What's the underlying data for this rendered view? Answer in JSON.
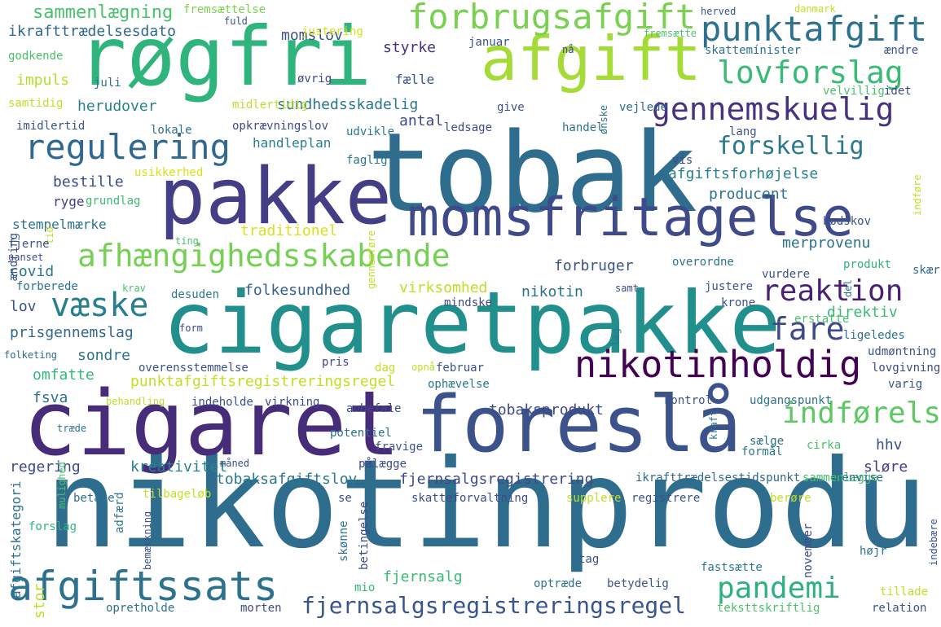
{
  "word_cloud": {
    "words": [
      {
        "text": "nikotinprodukt",
        "color": "#2f6d8e"
      },
      {
        "text": "tobak",
        "color": "#2f6d8e"
      },
      {
        "text": "cigaretpakke",
        "color": "#21908d"
      },
      {
        "text": "røgfri",
        "color": "#2fb47c"
      },
      {
        "text": "pakke",
        "color": "#433e85"
      },
      {
        "text": "cigaret",
        "color": "#472c7a"
      },
      {
        "text": "foreslå",
        "color": "#3b528b"
      },
      {
        "text": "afgift",
        "color": "#a5db36"
      },
      {
        "text": "momsfritagelse",
        "color": "#3e4a89"
      },
      {
        "text": "afgiftssats",
        "color": "#2c718e"
      },
      {
        "text": "forbrugsafgift",
        "color": "#7ad151"
      },
      {
        "text": "punktafgift",
        "color": "#2c728e"
      },
      {
        "text": "lovforslag",
        "color": "#3aba76"
      },
      {
        "text": "afhængighedsskabende",
        "color": "#75d054"
      },
      {
        "text": "nikotinholdig",
        "color": "#440154"
      },
      {
        "text": "regulering",
        "color": "#31688e"
      },
      {
        "text": "gennemskuelig",
        "color": "#46327e"
      },
      {
        "text": "pandemi",
        "color": "#2db27d"
      },
      {
        "text": "reaktion",
        "color": "#482173"
      },
      {
        "text": "indførelse",
        "color": "#5ec962"
      },
      {
        "text": "væske",
        "color": "#277f8e"
      },
      {
        "text": "fare",
        "color": "#3e4989"
      },
      {
        "text": "forskellig",
        "color": "#2a788e"
      },
      {
        "text": "fjernsalgsregistreringsregel",
        "color": "#39558c"
      },
      {
        "text": "sammenlægning",
        "color": "#4ac16d"
      },
      {
        "text": "fremsættelse",
        "color": "#7ad151"
      },
      {
        "text": "ikrafttrædelsesdato",
        "color": "#31688e"
      },
      {
        "text": "momslov",
        "color": "#3b528b"
      },
      {
        "text": "styrke",
        "color": "#46307e"
      },
      {
        "text": "impuls",
        "color": "#b5de2b"
      },
      {
        "text": "fælle",
        "color": "#3b528b"
      },
      {
        "text": "herudover",
        "color": "#26828e"
      },
      {
        "text": "sundhedsskadelig",
        "color": "#2a788e"
      },
      {
        "text": "antal",
        "color": "#3e4989"
      },
      {
        "text": "handleplan",
        "color": "#277f8e"
      },
      {
        "text": "afgiftsforhøjelse",
        "color": "#26828e"
      },
      {
        "text": "producent",
        "color": "#2c728e"
      },
      {
        "text": "bestille",
        "color": "#3e4a89"
      },
      {
        "text": "ryge",
        "color": "#433e85"
      },
      {
        "text": "stempelmærke",
        "color": "#2c728e"
      },
      {
        "text": "traditionel",
        "color": "#d8e219"
      },
      {
        "text": "merprovenu",
        "color": "#2c728e"
      },
      {
        "text": "forbruger",
        "color": "#3b528b"
      },
      {
        "text": "covid",
        "color": "#2a788e"
      },
      {
        "text": "folkesundhed",
        "color": "#35608d"
      },
      {
        "text": "virksomhed",
        "color": "#bddf26"
      },
      {
        "text": "nikotin",
        "color": "#2c728e"
      },
      {
        "text": "lov",
        "color": "#3b528b"
      },
      {
        "text": "prisgennemslag",
        "color": "#31688e"
      },
      {
        "text": "direktiv",
        "color": "#3aba76"
      },
      {
        "text": "sondre",
        "color": "#2c728e"
      },
      {
        "text": "omfatte",
        "color": "#35b779"
      },
      {
        "text": "punktafgiftsregistreringsregel",
        "color": "#c2df23"
      },
      {
        "text": "fsva",
        "color": "#2c728e"
      },
      {
        "text": "tobaksprodukt",
        "color": "#3e4989"
      },
      {
        "text": "hhv",
        "color": "#3b528b"
      },
      {
        "text": "regering",
        "color": "#3e4989"
      },
      {
        "text": "kreativitet",
        "color": "#25848e"
      },
      {
        "text": "tobaksafgiftslov",
        "color": "#2a788e"
      },
      {
        "text": "fjernsalgsregistrering",
        "color": "#3e4989"
      },
      {
        "text": "sløre",
        "color": "#433e85"
      },
      {
        "text": "afgiftskategori",
        "color": "#2c728e"
      },
      {
        "text": "forslag",
        "color": "#2fb47c"
      },
      {
        "text": "stor",
        "color": "#bddf26"
      },
      {
        "text": "fjernsalg",
        "color": "#3aba76"
      },
      {
        "text": "optræde",
        "color": "#2c728e"
      },
      {
        "text": "betydelig",
        "color": "#3b528b"
      },
      {
        "text": "teksttskriftlig",
        "color": "#4ac16d"
      },
      {
        "text": "relation",
        "color": "#3b528b"
      },
      {
        "text": "opretholde",
        "color": "#2c728e"
      },
      {
        "text": "morten",
        "color": "#3e4989"
      },
      {
        "text": "mio",
        "color": "#35b779"
      },
      {
        "text": "ikrafttrædelsestidspunkt",
        "color": "#31688e"
      },
      {
        "text": "sammenlægge",
        "color": "#4ac16d"
      },
      {
        "text": "henvise",
        "color": "#2c728e"
      },
      {
        "text": "skatteforvaltning",
        "color": "#3e4989"
      },
      {
        "text": "registrere",
        "color": "#3b528b"
      },
      {
        "text": "supplere",
        "color": "#bddf26"
      },
      {
        "text": "berøre",
        "color": "#c2df23"
      },
      {
        "text": "skattemínister",
        "color": "#2c728e"
      },
      {
        "text": "ændre",
        "color": "#3b528b"
      },
      {
        "text": "velvillig",
        "color": "#4ac16d"
      },
      {
        "text": "idet",
        "color": "#3e4989"
      },
      {
        "text": "vejlede",
        "color": "#31688e"
      },
      {
        "text": "give",
        "color": "#3b528b"
      },
      {
        "text": "ledsage",
        "color": "#3e4989"
      },
      {
        "text": "handel",
        "color": "#2c728e"
      },
      {
        "text": "lang",
        "color": "#3b528b"
      },
      {
        "text": "udvikle",
        "color": "#2a788e"
      },
      {
        "text": "opkrævningslov",
        "color": "#3e4989"
      },
      {
        "text": "midlertidig",
        "color": "#bddf26"
      },
      {
        "text": "imidlertid",
        "color": "#3b528b"
      },
      {
        "text": "lokale",
        "color": "#2c728e"
      },
      {
        "text": "samtidig",
        "color": "#c2df23"
      },
      {
        "text": "godkende",
        "color": "#4ac16d"
      },
      {
        "text": "juli",
        "color": "#2c728e"
      },
      {
        "text": "fuld",
        "color": "#3b528b"
      },
      {
        "text": "justering",
        "color": "#d8e219"
      },
      {
        "text": "januar",
        "color": "#3b528b"
      },
      {
        "text": "nå",
        "color": "#3e4989"
      },
      {
        "text": "fremsætte",
        "color": "#4ac16d"
      },
      {
        "text": "herved",
        "color": "#3b528b"
      },
      {
        "text": "danmark",
        "color": "#c2df23"
      },
      {
        "text": "ønske",
        "color": "#2c728e"
      },
      {
        "text": "øvrig",
        "color": "#3e4989"
      },
      {
        "text": "faglig",
        "color": "#2a788e"
      },
      {
        "text": "usikkerhed",
        "color": "#d8e219"
      },
      {
        "text": "grundlag",
        "color": "#3aba76"
      },
      {
        "text": "tid",
        "color": "#bddf26"
      },
      {
        "text": "ændring",
        "color": "#3b528b"
      },
      {
        "text": "vis",
        "color": "#3e4989"
      },
      {
        "text": "bødskov",
        "color": "#3b528b"
      },
      {
        "text": "del",
        "color": "#2c728e"
      },
      {
        "text": "indføre",
        "color": "#bddf26"
      },
      {
        "text": "gennemføre",
        "color": "#c2df23"
      },
      {
        "text": "ting",
        "color": "#4ac16d"
      },
      {
        "text": "fjerne",
        "color": "#3b528b"
      },
      {
        "text": "uanset",
        "color": "#3e4989"
      },
      {
        "text": "overordne",
        "color": "#2c728e"
      },
      {
        "text": "produkt",
        "color": "#2fb47c"
      },
      {
        "text": "skærpe",
        "color": "#31688e"
      },
      {
        "text": "vurdere",
        "color": "#3b528b"
      },
      {
        "text": "forberede",
        "color": "#2c728e"
      },
      {
        "text": "krav",
        "color": "#4ac16d"
      },
      {
        "text": "desuden",
        "color": "#2a788e"
      },
      {
        "text": "samt",
        "color": "#3e4989"
      },
      {
        "text": "justere",
        "color": "#3b528b"
      },
      {
        "text": "læg",
        "color": "#2c728e"
      },
      {
        "text": "krone",
        "color": "#3b528b"
      },
      {
        "text": "mindske",
        "color": "#3e4989"
      },
      {
        "text": "erstatte",
        "color": "#4ac16d"
      },
      {
        "text": "ligeledes",
        "color": "#2c728e"
      },
      {
        "text": "udmøntning",
        "color": "#3b528b"
      },
      {
        "text": "form",
        "color": "#3e4989"
      },
      {
        "text": "folketing",
        "color": "#31688e"
      },
      {
        "text": "overensstemmelse",
        "color": "#3b528b"
      },
      {
        "text": "pris",
        "color": "#3e4989"
      },
      {
        "text": "dag",
        "color": "#c2df23"
      },
      {
        "text": "opnå",
        "color": "#bddf26"
      },
      {
        "text": "februar",
        "color": "#3b528b"
      },
      {
        "text": "lovgivning",
        "color": "#3e4989"
      },
      {
        "text": "kraft",
        "color": "#2c728e"
      },
      {
        "text": "varig",
        "color": "#3b528b"
      },
      {
        "text": "ophævelse",
        "color": "#2a788e"
      },
      {
        "text": "behandling",
        "color": "#bddf26"
      },
      {
        "text": "indeholde",
        "color": "#3b528b"
      },
      {
        "text": "virkning",
        "color": "#3e4989"
      },
      {
        "text": "kontrol",
        "color": "#3b528b"
      },
      {
        "text": "udgangspunkt",
        "color": "#2c728e"
      },
      {
        "text": "anbefale",
        "color": "#3e4989"
      },
      {
        "text": "potentiel",
        "color": "#2c728e"
      },
      {
        "text": "fravige",
        "color": "#3b528b"
      },
      {
        "text": "pålægge",
        "color": "#3e4989"
      },
      {
        "text": "måned",
        "color": "#3b528b"
      },
      {
        "text": "sælge",
        "color": "#2c728e"
      },
      {
        "text": "cirka",
        "color": "#4ac16d"
      },
      {
        "text": "formål",
        "color": "#2a788e"
      },
      {
        "text": "træde",
        "color": "#2c728e"
      },
      {
        "text": "mulighed",
        "color": "#4ac16d"
      },
      {
        "text": "adfærd",
        "color": "#2a788e"
      },
      {
        "text": "tilbageløb",
        "color": "#c2df23"
      },
      {
        "text": "se",
        "color": "#3e4989"
      },
      {
        "text": "betale",
        "color": "#2c728e"
      },
      {
        "text": "bemærkning",
        "color": "#3b528b"
      },
      {
        "text": "skønne",
        "color": "#2c728e"
      },
      {
        "text": "betingelse",
        "color": "#3e4989"
      },
      {
        "text": "tag",
        "color": "#3b528b"
      },
      {
        "text": "november",
        "color": "#3e4989"
      },
      {
        "text": "højr",
        "color": "#2c728e"
      },
      {
        "text": "indebære",
        "color": "#3b528b"
      },
      {
        "text": "fastsætte",
        "color": "#2a788e"
      },
      {
        "text": "tillade",
        "color": "#bddf26"
      }
    ]
  }
}
